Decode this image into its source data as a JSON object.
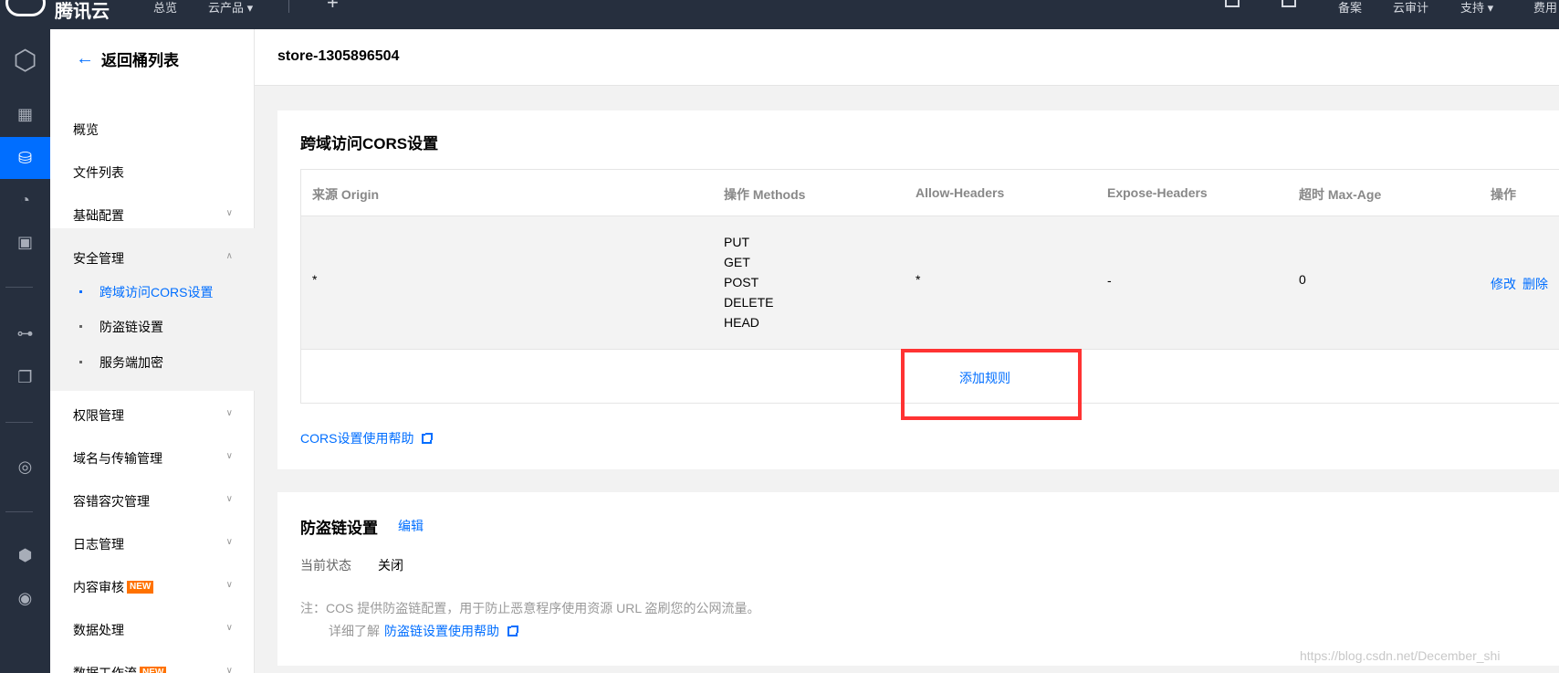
{
  "topbar": {
    "brand": "腾讯云",
    "nav_overview": "总览",
    "nav_products": "云产品 ▾",
    "nav_beian": "备案",
    "nav_audit": "云审计",
    "nav_support": "支持 ▾",
    "nav_cost": "费用"
  },
  "menu": {
    "back_label": "返回桶列表",
    "items": [
      {
        "label": "概览"
      },
      {
        "label": "文件列表"
      },
      {
        "label": "基础配置"
      },
      {
        "label": "安全管理"
      },
      {
        "label": "权限管理"
      },
      {
        "label": "域名与传输管理"
      },
      {
        "label": "容错容灾管理"
      },
      {
        "label": "日志管理"
      },
      {
        "label": "内容审核"
      },
      {
        "label": "数据处理"
      },
      {
        "label": "数据工作流"
      }
    ],
    "security_sub": [
      {
        "label": "跨域访问CORS设置"
      },
      {
        "label": "防盗链设置"
      },
      {
        "label": "服务端加密"
      }
    ],
    "new_badge": "NEW"
  },
  "header": {
    "bucket_name": "store-1305896504"
  },
  "cors": {
    "title": "跨域访问CORS设置",
    "columns": [
      "来源 Origin",
      "操作 Methods",
      "Allow-Headers",
      "Expose-Headers",
      "超时 Max-Age",
      "操作"
    ],
    "rows": [
      {
        "origin": "*",
        "methods": [
          "PUT",
          "GET",
          "POST",
          "DELETE",
          "HEAD"
        ],
        "allow_headers": "*",
        "expose_headers": "-",
        "max_age": "0",
        "action_edit": "修改",
        "action_delete": "删除"
      }
    ],
    "add_rule": "添加规则",
    "help_link": "CORS设置使用帮助"
  },
  "hotlink": {
    "title": "防盗链设置",
    "edit": "编辑",
    "status_label": "当前状态",
    "status_value": "关闭",
    "note": "注：COS 提供防盗链配置，用于防止恶意程序使用资源 URL 盗刷您的公网流量。",
    "learn_more": "详细了解",
    "help_link": "防盗链设置使用帮助"
  },
  "watermark": "https://blog.csdn.net/December_shi",
  "colors": {
    "accent": "#006eff",
    "topbar": "#262f3e",
    "highlight": "#ff3333",
    "badge": "#ff7200"
  }
}
